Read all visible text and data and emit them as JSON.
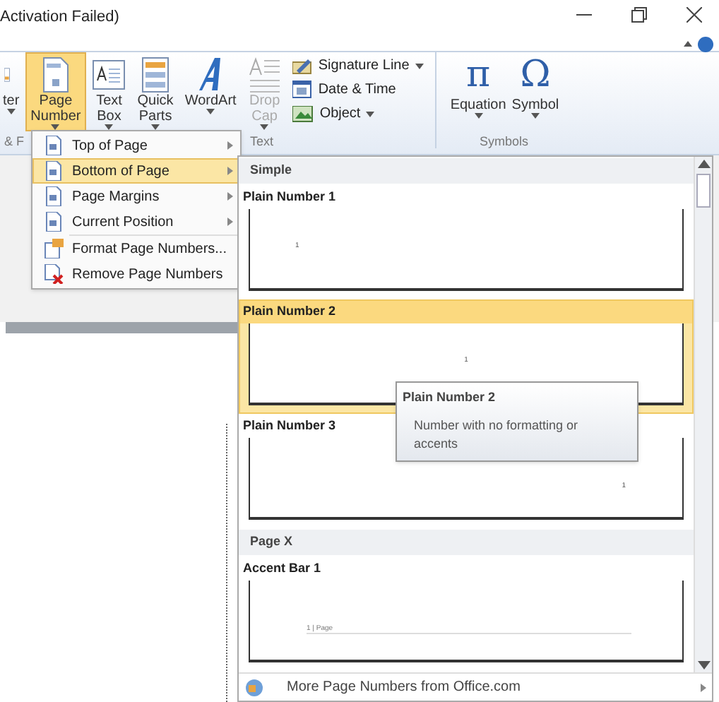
{
  "window": {
    "title": "Activation Failed)"
  },
  "ribbon": {
    "buttons": [
      {
        "kind": "cut",
        "lines": [
          "ter"
        ],
        "dropdown": true,
        "selected": false,
        "disabled": false
      },
      {
        "kind": "page",
        "lines": [
          "Page",
          "Number"
        ],
        "dropdown": true,
        "selected": true,
        "disabled": false
      },
      {
        "kind": "textbox",
        "lines": [
          "Text",
          "Box"
        ],
        "dropdown": true,
        "selected": false,
        "disabled": false
      },
      {
        "kind": "parts",
        "lines": [
          "Quick",
          "Parts"
        ],
        "dropdown": true,
        "selected": false,
        "disabled": false
      },
      {
        "kind": "wordart",
        "lines": [
          "WordArt"
        ],
        "dropdown": true,
        "selected": false,
        "disabled": false
      },
      {
        "kind": "dropcap",
        "lines": [
          "Drop",
          "Cap"
        ],
        "dropdown": true,
        "selected": false,
        "disabled": true
      }
    ],
    "small_buttons": [
      {
        "kind": "signature",
        "label": "Signature Line",
        "dropdown": true
      },
      {
        "kind": "date",
        "label": "Date & Time",
        "dropdown": false
      },
      {
        "kind": "object",
        "label": "Object",
        "dropdown": true
      }
    ],
    "symbol_buttons": [
      {
        "glyph": "π",
        "label": "Equation"
      },
      {
        "glyph": "Ω",
        "label": "Symbol"
      }
    ],
    "groups": [
      "& F",
      "Text",
      "Symbols"
    ]
  },
  "menu": {
    "items": [
      {
        "kind": "page",
        "label": "Top of Page",
        "submenu": true,
        "selected": false
      },
      {
        "kind": "page",
        "label": "Bottom of Page",
        "submenu": true,
        "selected": true
      },
      {
        "kind": "page",
        "label": "Page Margins",
        "submenu": true,
        "selected": false
      },
      {
        "kind": "page",
        "label": "Current Position",
        "submenu": true,
        "selected": false
      },
      {
        "kind": "format",
        "label": "Format Page Numbers...",
        "submenu": false,
        "selected": false
      },
      {
        "kind": "remove",
        "label": "Remove Page Numbers",
        "submenu": false,
        "selected": false
      }
    ]
  },
  "gallery": {
    "sections": [
      {
        "heading": "Simple",
        "items": [
          {
            "name": "Plain Number 1",
            "kind": "left",
            "preview": "1",
            "selected": false
          },
          {
            "name": "Plain Number 2",
            "kind": "center",
            "preview": "1",
            "selected": true
          },
          {
            "name": "Plain Number 3",
            "kind": "right",
            "preview": "1",
            "selected": false
          }
        ]
      },
      {
        "heading": "Page X",
        "items": [
          {
            "name": "Accent Bar 1",
            "kind": "accent",
            "preview": "1 | Page",
            "selected": false
          }
        ]
      }
    ],
    "tooltip": {
      "title": "Plain Number 2",
      "text": "Number with no formatting or accents"
    },
    "footer": "More Page Numbers from Office.com"
  }
}
